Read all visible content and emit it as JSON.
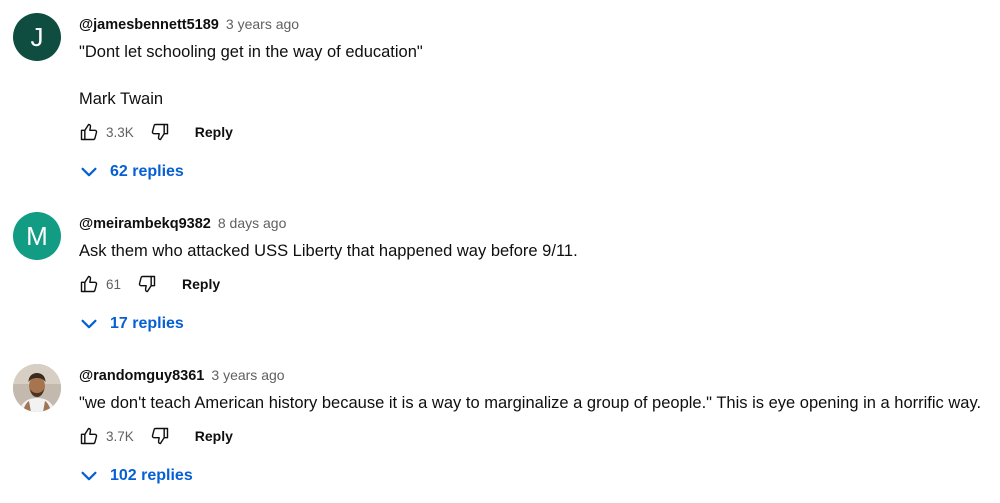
{
  "colors": {
    "avatar_j": "#0e4d40",
    "avatar_m": "#119c83",
    "link": "#065fd4",
    "meta": "#606060"
  },
  "comments": [
    {
      "avatar_letter": "J",
      "author": "@jamesbennett5189",
      "time": "3 years ago",
      "lines": [
        "\"Dont let schooling get in the way of education\"",
        "Mark Twain"
      ],
      "likes": "3.3K",
      "reply_label": "Reply",
      "replies_label": "62 replies",
      "icons": [
        "like-icon",
        "dislike-icon",
        "chevron-down-icon"
      ]
    },
    {
      "avatar_letter": "M",
      "author": "@meirambekq9382",
      "time": "8 days ago",
      "lines": [
        "Ask them who attacked USS Liberty that happened way before 9/11."
      ],
      "likes": "61",
      "reply_label": "Reply",
      "replies_label": "17 replies",
      "icons": [
        "like-icon",
        "dislike-icon",
        "chevron-down-icon"
      ]
    },
    {
      "avatar_letter": "",
      "author": "@randomguy8361",
      "time": "3 years ago",
      "lines": [
        "\"we don't teach American history because it is a way to marginalize a group of people.\"  This is eye opening in a horrific way."
      ],
      "likes": "3.7K",
      "reply_label": "Reply",
      "replies_label": "102 replies",
      "icons": [
        "like-icon",
        "dislike-icon",
        "chevron-down-icon"
      ]
    }
  ]
}
